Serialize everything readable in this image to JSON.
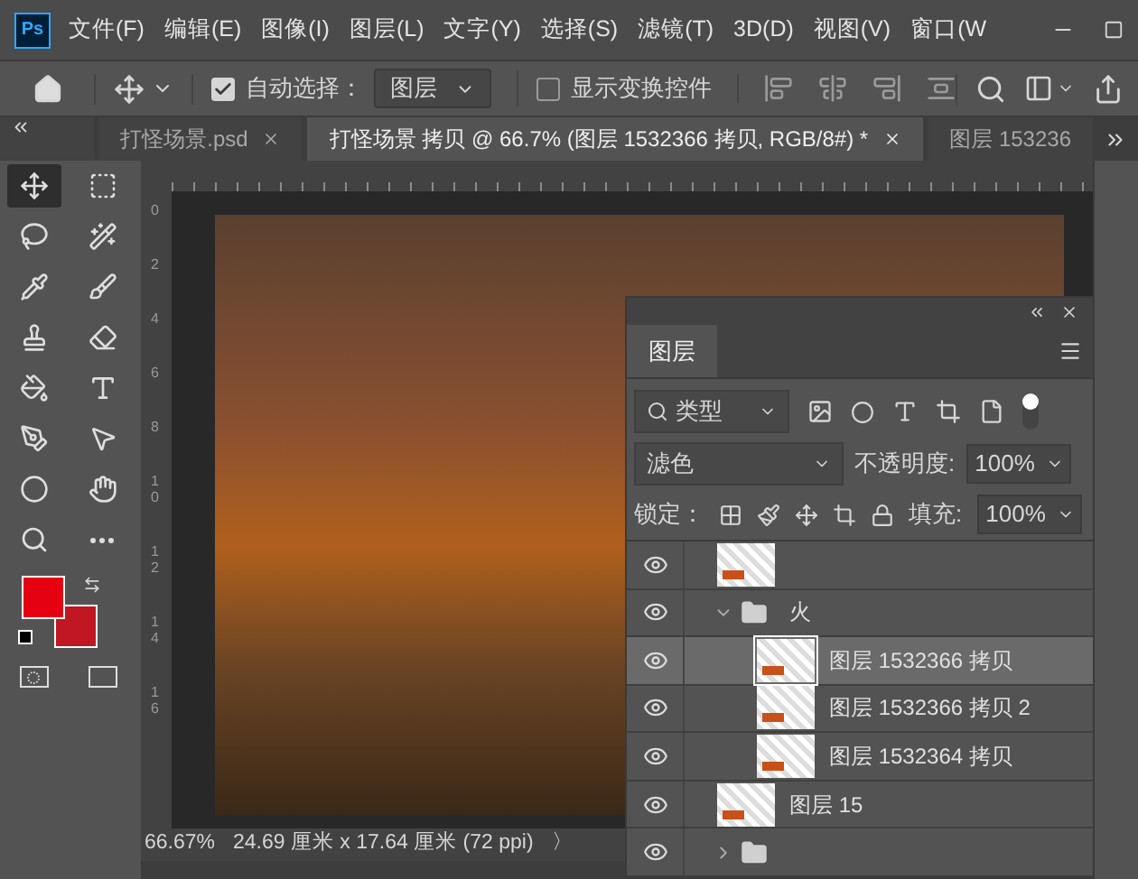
{
  "app_logo": "Ps",
  "menu": [
    "文件(F)",
    "编辑(E)",
    "图像(I)",
    "图层(L)",
    "文字(Y)",
    "选择(S)",
    "滤镜(T)",
    "3D(D)",
    "视图(V)",
    "窗口(W"
  ],
  "options_bar": {
    "auto_select": {
      "label": "自动选择：",
      "checked": true
    },
    "auto_select_target": "图层",
    "transform_controls": {
      "label": "显示变换控件",
      "checked": false
    }
  },
  "tabs": [
    {
      "label": "打怪场景.psd",
      "selected": false,
      "closable": true
    },
    {
      "label": "打怪场景 拷贝 @ 66.7% (图层 1532366 拷贝, RGB/8#) *",
      "selected": true,
      "closable": true
    },
    {
      "label": "图层 153236",
      "selected": false,
      "closable": false
    }
  ],
  "tools": [
    {
      "kind": "move",
      "selected": true
    },
    {
      "kind": "marquee",
      "selected": false
    },
    {
      "kind": "lasso",
      "selected": false
    },
    {
      "kind": "wand",
      "selected": false
    },
    {
      "kind": "eyedropper",
      "selected": false
    },
    {
      "kind": "brush",
      "selected": false
    },
    {
      "kind": "stamp",
      "selected": false
    },
    {
      "kind": "eraser",
      "selected": false
    },
    {
      "kind": "bucket",
      "selected": false
    },
    {
      "kind": "type",
      "selected": false
    },
    {
      "kind": "pen",
      "selected": false
    },
    {
      "kind": "pointer",
      "selected": false
    },
    {
      "kind": "ellipse",
      "selected": false
    },
    {
      "kind": "hand",
      "selected": false
    },
    {
      "kind": "zoom",
      "selected": false
    },
    {
      "kind": "more",
      "selected": false
    }
  ],
  "swatches": [
    {
      "kind": "foreground",
      "color": "#e50012"
    },
    {
      "kind": "background",
      "color": "#c01722"
    }
  ],
  "vertical_ruler": [
    "0",
    "2",
    "4",
    "6",
    "8",
    "10",
    "12",
    "14",
    "16"
  ],
  "status_bar": {
    "zoom": "66.67%",
    "doc_size": "24.69 厘米 x 17.64 厘米 (72 ppi)",
    "more": "〉"
  },
  "layers_panel": {
    "tab": "图层",
    "filter": "类型",
    "blend_mode": "滤色",
    "opacity_label": "不透明度:",
    "opacity": "100%",
    "lock_label": "锁定：",
    "fill_label": "填充:",
    "fill": "100%",
    "layers": [
      {
        "kind": "layer",
        "visible": true,
        "selected": false
      },
      {
        "kind": "group",
        "name": "火",
        "visible": true,
        "selected": false,
        "expanded": true,
        "children": [
          {
            "kind": "layer",
            "name": "图层 1532366 拷贝",
            "visible": true,
            "selected": true
          },
          {
            "kind": "layer",
            "name": "图层 1532366 拷贝 2",
            "visible": true,
            "selected": false
          },
          {
            "kind": "layer",
            "name": "图层 1532364 拷贝",
            "visible": true,
            "selected": false
          }
        ]
      },
      {
        "kind": "layer",
        "name": "图层 15",
        "visible": true,
        "selected": false
      },
      {
        "kind": "group",
        "visible": true,
        "selected": false,
        "expanded": false
      }
    ]
  }
}
